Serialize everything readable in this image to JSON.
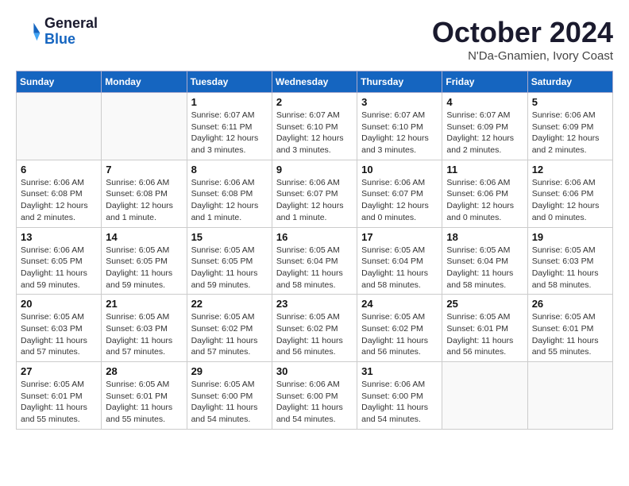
{
  "header": {
    "logo_line1": "General",
    "logo_line2": "Blue",
    "month_title": "October 2024",
    "subtitle": "N'Da-Gnamien, Ivory Coast"
  },
  "weekdays": [
    "Sunday",
    "Monday",
    "Tuesday",
    "Wednesday",
    "Thursday",
    "Friday",
    "Saturday"
  ],
  "weeks": [
    [
      {
        "day": "",
        "detail": ""
      },
      {
        "day": "",
        "detail": ""
      },
      {
        "day": "1",
        "detail": "Sunrise: 6:07 AM\nSunset: 6:11 PM\nDaylight: 12 hours\nand 3 minutes."
      },
      {
        "day": "2",
        "detail": "Sunrise: 6:07 AM\nSunset: 6:10 PM\nDaylight: 12 hours\nand 3 minutes."
      },
      {
        "day": "3",
        "detail": "Sunrise: 6:07 AM\nSunset: 6:10 PM\nDaylight: 12 hours\nand 3 minutes."
      },
      {
        "day": "4",
        "detail": "Sunrise: 6:07 AM\nSunset: 6:09 PM\nDaylight: 12 hours\nand 2 minutes."
      },
      {
        "day": "5",
        "detail": "Sunrise: 6:06 AM\nSunset: 6:09 PM\nDaylight: 12 hours\nand 2 minutes."
      }
    ],
    [
      {
        "day": "6",
        "detail": "Sunrise: 6:06 AM\nSunset: 6:08 PM\nDaylight: 12 hours\nand 2 minutes."
      },
      {
        "day": "7",
        "detail": "Sunrise: 6:06 AM\nSunset: 6:08 PM\nDaylight: 12 hours\nand 1 minute."
      },
      {
        "day": "8",
        "detail": "Sunrise: 6:06 AM\nSunset: 6:08 PM\nDaylight: 12 hours\nand 1 minute."
      },
      {
        "day": "9",
        "detail": "Sunrise: 6:06 AM\nSunset: 6:07 PM\nDaylight: 12 hours\nand 1 minute."
      },
      {
        "day": "10",
        "detail": "Sunrise: 6:06 AM\nSunset: 6:07 PM\nDaylight: 12 hours\nand 0 minutes."
      },
      {
        "day": "11",
        "detail": "Sunrise: 6:06 AM\nSunset: 6:06 PM\nDaylight: 12 hours\nand 0 minutes."
      },
      {
        "day": "12",
        "detail": "Sunrise: 6:06 AM\nSunset: 6:06 PM\nDaylight: 12 hours\nand 0 minutes."
      }
    ],
    [
      {
        "day": "13",
        "detail": "Sunrise: 6:06 AM\nSunset: 6:05 PM\nDaylight: 11 hours\nand 59 minutes."
      },
      {
        "day": "14",
        "detail": "Sunrise: 6:05 AM\nSunset: 6:05 PM\nDaylight: 11 hours\nand 59 minutes."
      },
      {
        "day": "15",
        "detail": "Sunrise: 6:05 AM\nSunset: 6:05 PM\nDaylight: 11 hours\nand 59 minutes."
      },
      {
        "day": "16",
        "detail": "Sunrise: 6:05 AM\nSunset: 6:04 PM\nDaylight: 11 hours\nand 58 minutes."
      },
      {
        "day": "17",
        "detail": "Sunrise: 6:05 AM\nSunset: 6:04 PM\nDaylight: 11 hours\nand 58 minutes."
      },
      {
        "day": "18",
        "detail": "Sunrise: 6:05 AM\nSunset: 6:04 PM\nDaylight: 11 hours\nand 58 minutes."
      },
      {
        "day": "19",
        "detail": "Sunrise: 6:05 AM\nSunset: 6:03 PM\nDaylight: 11 hours\nand 58 minutes."
      }
    ],
    [
      {
        "day": "20",
        "detail": "Sunrise: 6:05 AM\nSunset: 6:03 PM\nDaylight: 11 hours\nand 57 minutes."
      },
      {
        "day": "21",
        "detail": "Sunrise: 6:05 AM\nSunset: 6:03 PM\nDaylight: 11 hours\nand 57 minutes."
      },
      {
        "day": "22",
        "detail": "Sunrise: 6:05 AM\nSunset: 6:02 PM\nDaylight: 11 hours\nand 57 minutes."
      },
      {
        "day": "23",
        "detail": "Sunrise: 6:05 AM\nSunset: 6:02 PM\nDaylight: 11 hours\nand 56 minutes."
      },
      {
        "day": "24",
        "detail": "Sunrise: 6:05 AM\nSunset: 6:02 PM\nDaylight: 11 hours\nand 56 minutes."
      },
      {
        "day": "25",
        "detail": "Sunrise: 6:05 AM\nSunset: 6:01 PM\nDaylight: 11 hours\nand 56 minutes."
      },
      {
        "day": "26",
        "detail": "Sunrise: 6:05 AM\nSunset: 6:01 PM\nDaylight: 11 hours\nand 55 minutes."
      }
    ],
    [
      {
        "day": "27",
        "detail": "Sunrise: 6:05 AM\nSunset: 6:01 PM\nDaylight: 11 hours\nand 55 minutes."
      },
      {
        "day": "28",
        "detail": "Sunrise: 6:05 AM\nSunset: 6:01 PM\nDaylight: 11 hours\nand 55 minutes."
      },
      {
        "day": "29",
        "detail": "Sunrise: 6:05 AM\nSunset: 6:00 PM\nDaylight: 11 hours\nand 54 minutes."
      },
      {
        "day": "30",
        "detail": "Sunrise: 6:06 AM\nSunset: 6:00 PM\nDaylight: 11 hours\nand 54 minutes."
      },
      {
        "day": "31",
        "detail": "Sunrise: 6:06 AM\nSunset: 6:00 PM\nDaylight: 11 hours\nand 54 minutes."
      },
      {
        "day": "",
        "detail": ""
      },
      {
        "day": "",
        "detail": ""
      }
    ]
  ]
}
